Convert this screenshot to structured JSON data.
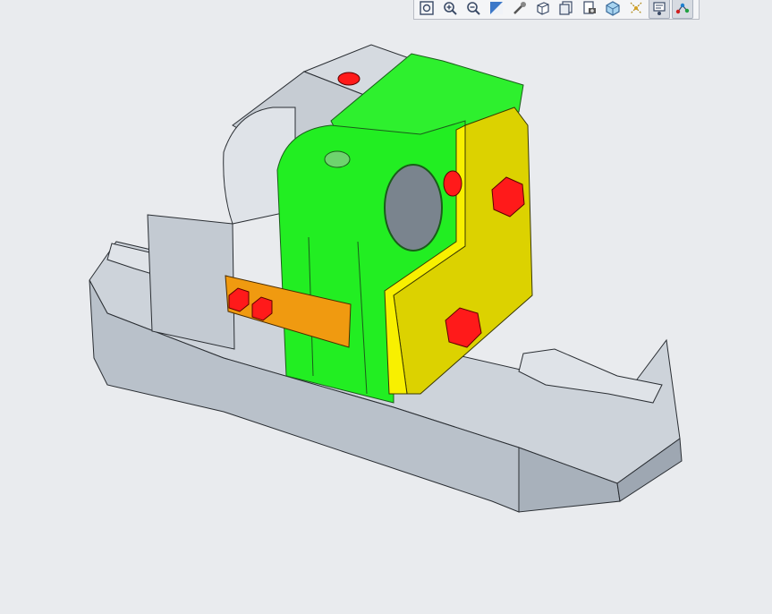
{
  "toolbar": {
    "buttons": [
      {
        "icon": "refit-icon"
      },
      {
        "icon": "zoom-in-icon"
      },
      {
        "icon": "zoom-out-icon"
      },
      {
        "icon": "repaint-icon"
      },
      {
        "icon": "spin-center-icon"
      },
      {
        "icon": "display-style-icon"
      },
      {
        "icon": "saved-orientations-icon"
      },
      {
        "icon": "view-manager-icon"
      },
      {
        "icon": "perspective-icon"
      },
      {
        "icon": "datum-display-icon"
      },
      {
        "icon": "annotation-display-icon",
        "active": true
      },
      {
        "icon": "connection-display-icon",
        "active": true
      }
    ]
  },
  "model": {
    "colors": {
      "base": "#c5ccd4",
      "green": "#22ee22",
      "yellow": "#e8e000",
      "orange": "#f09a10",
      "bolt": "#ff1010",
      "background": "#e9ebee"
    }
  }
}
